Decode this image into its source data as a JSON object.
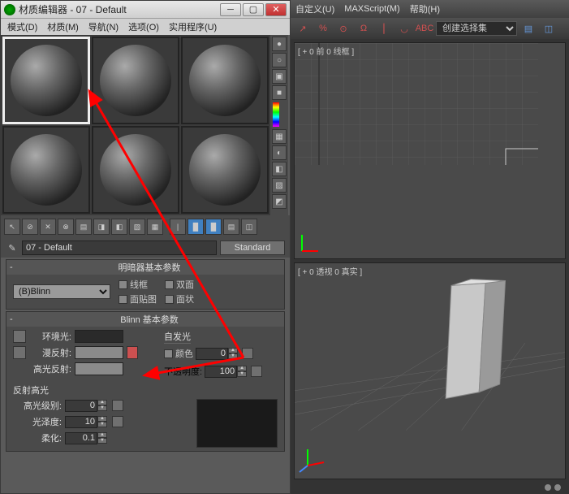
{
  "window": {
    "title": "材质编辑器 - 07 - Default"
  },
  "menu": {
    "mode": "模式(D)",
    "material": "材质(M)",
    "navigate": "导航(N)",
    "options": "选项(O)",
    "utilities": "实用程序(U)"
  },
  "material_name": "07 - Default",
  "material_type": "Standard",
  "rollouts": {
    "shader": {
      "title": "明暗器基本参数",
      "shader": "(B)Blinn",
      "wireframe": "线框",
      "two_sided": "双面",
      "face_map": "面贴图",
      "faceted": "面状"
    },
    "blinn": {
      "title": "Blinn 基本参数",
      "ambient": "环境光:",
      "diffuse": "漫反射:",
      "specular": "高光反射:",
      "self_illum_hdr": "自发光",
      "color_lbl": "颜色",
      "color_val": "0",
      "opacity_lbl": "不透明度:",
      "opacity_val": "100",
      "hilite_hdr": "反射高光",
      "spec_level_lbl": "高光级别:",
      "spec_level_val": "0",
      "gloss_lbl": "光泽度:",
      "gloss_val": "10",
      "soften_lbl": "柔化:",
      "soften_val": "0.1"
    }
  },
  "viewport_menu": {
    "customize": "自定义(U)",
    "maxscript": "MAXScript(M)",
    "help": "帮助(H)"
  },
  "viewport_toolbar": {
    "create_sel_set": "创建选择集"
  },
  "vp_labels": {
    "front": "[ + 0 前 0 线框 ]",
    "persp": "[ + 0 透视 0 真实 ]"
  },
  "side_tool_icons": [
    "●",
    "○",
    "▣",
    "■",
    "▦",
    "◐",
    "◧",
    "▨",
    "◩",
    "◫"
  ],
  "toolbar_icons": [
    "↖",
    "⊘",
    "✕",
    "⊗",
    "▤",
    "◨",
    "◧",
    "▧",
    "▦",
    "|",
    "█",
    "█",
    "▤",
    "◫"
  ],
  "vp_tool_icons": [
    "↗",
    "%",
    "⊙",
    "Ω",
    "⎮",
    "◡",
    "ABC"
  ]
}
